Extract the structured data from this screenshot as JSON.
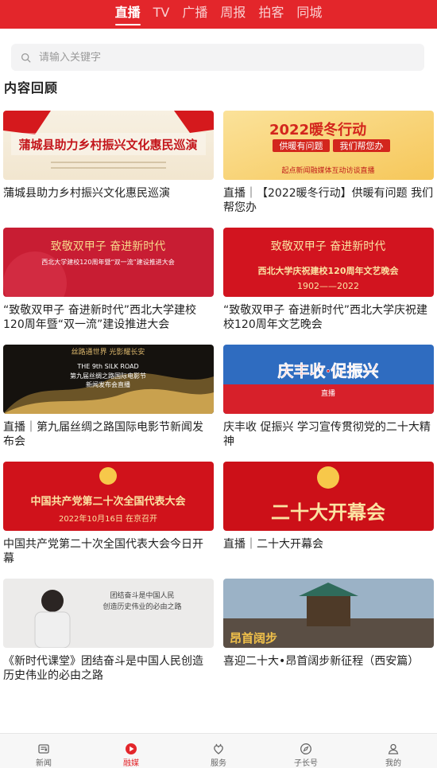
{
  "tabs": [
    {
      "label": "直播",
      "active": true
    },
    {
      "label": "TV",
      "active": false
    },
    {
      "label": "广播",
      "active": false
    },
    {
      "label": "周报",
      "active": false
    },
    {
      "label": "拍客",
      "active": false
    },
    {
      "label": "同城",
      "active": false
    }
  ],
  "search": {
    "placeholder": "请输入关键字"
  },
  "section_title": "内容回顾",
  "cards": [
    {
      "caption": "蒲城县助力乡村振兴文化惠民巡演",
      "thumb_text": "蒲城县助力乡村振兴文化惠民巡演"
    },
    {
      "caption": "直播｜【2022暖冬行动】供暖有问题 我们帮您办",
      "thumb_text": "2022暖冬行动",
      "thumb_sub1": "供暖有问题",
      "thumb_sub2": "我们帮您办",
      "thumb_sub3": "起点新闻融媒体互动访谈直播"
    },
    {
      "caption": "“致敬双甲子 奋进新时代”西北大学建校120周年暨“双一流”建设推进大会",
      "thumb_text": "致敬双甲子 奋进新时代",
      "thumb_sub1": "西北大学建校120周年暨“双一流”建设推进大会"
    },
    {
      "caption": "“致敬双甲子 奋进新时代”西北大学庆祝建校120周年文艺晚会",
      "thumb_text": "致敬双甲子 奋进新时代",
      "thumb_sub1": "西北大学庆祝建校120周年文艺晚会",
      "thumb_sub2": "1902——2022"
    },
    {
      "caption": "直播｜第九届丝绸之路国际电影节新闻发布会",
      "thumb_text": "丝路通世界 光影耀长安",
      "thumb_sub1": "THE 9th SILK ROAD",
      "thumb_sub2": "第九届丝绸之路国际电影节",
      "thumb_sub3": "新闻发布会直播"
    },
    {
      "caption": "庆丰收 促振兴 学习宣传贯彻党的二十大精神",
      "thumb_text": "庆丰收·促振兴",
      "thumb_sub1": "直播"
    },
    {
      "caption": "中国共产党第二十次全国代表大会今日开幕",
      "thumb_text": "中国共产党第二十次全国代表大会",
      "thumb_sub1": "2022年10月16日 在京召开"
    },
    {
      "caption": "直播｜二十大开幕会",
      "thumb_text": "二十大开幕会"
    },
    {
      "caption": "《新时代课堂》团结奋斗是中国人民创造历史伟业的必由之路",
      "thumb_text": "团结奋斗是中国人民",
      "thumb_sub1": "创造历史伟业的必由之路"
    },
    {
      "caption": "喜迎二十大•昂首阔步新征程（西安篇）",
      "thumb_text": "昂首阔步"
    }
  ],
  "bottom_nav": [
    {
      "label": "新闻",
      "icon": "news-icon",
      "active": false
    },
    {
      "label": "融媒",
      "icon": "play-icon",
      "active": true
    },
    {
      "label": "服务",
      "icon": "service-icon",
      "active": false
    },
    {
      "label": "子长号",
      "icon": "compass-icon",
      "active": false
    },
    {
      "label": "我的",
      "icon": "user-icon",
      "active": false
    }
  ],
  "colors": {
    "brand_red": "#e3262b",
    "text": "#222222",
    "muted": "#9a9a9a"
  }
}
